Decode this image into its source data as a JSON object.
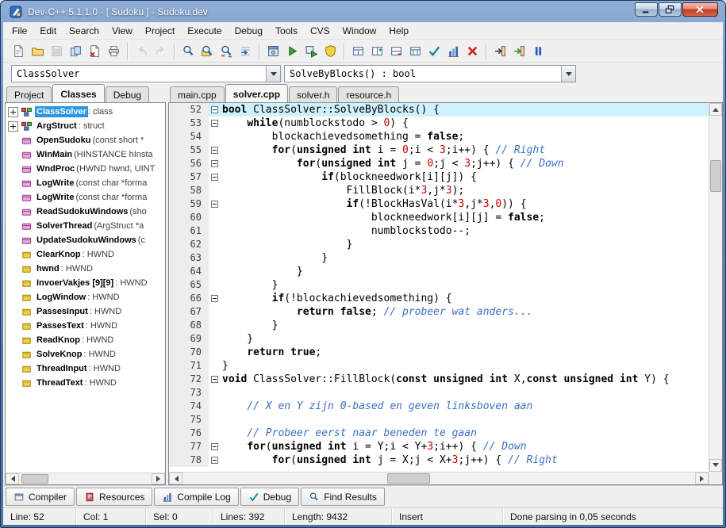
{
  "window": {
    "title": "Dev-C++ 5.1.1.0 - [ Sudoku ] - Sudoku.dev",
    "controls": [
      "minimize",
      "restore",
      "close"
    ]
  },
  "menu": {
    "items": [
      "File",
      "Edit",
      "Search",
      "View",
      "Project",
      "Execute",
      "Debug",
      "Tools",
      "CVS",
      "Window",
      "Help"
    ]
  },
  "toolbar": {
    "buttons": [
      {
        "name": "new-file"
      },
      {
        "name": "open"
      },
      {
        "name": "save",
        "disabled": true
      },
      {
        "name": "save-all"
      },
      {
        "name": "close-file"
      },
      {
        "name": "print"
      },
      {
        "sep": true
      },
      {
        "name": "undo",
        "disabled": true
      },
      {
        "name": "redo",
        "disabled": true
      },
      {
        "sep": true
      },
      {
        "name": "find"
      },
      {
        "name": "find-in-files"
      },
      {
        "name": "replace"
      },
      {
        "name": "goto-line"
      },
      {
        "sep": true
      },
      {
        "name": "compile"
      },
      {
        "name": "run"
      },
      {
        "name": "compile-run"
      },
      {
        "name": "rebuild-all"
      },
      {
        "sep": true
      },
      {
        "name": "project-new-source"
      },
      {
        "name": "project-add"
      },
      {
        "name": "project-remove"
      },
      {
        "name": "project-options"
      },
      {
        "name": "syntax-check"
      },
      {
        "name": "profile"
      },
      {
        "name": "abort"
      },
      {
        "sep": true
      },
      {
        "name": "goto-declaration"
      },
      {
        "name": "goto-implementation"
      },
      {
        "name": "pause"
      }
    ]
  },
  "navigator": {
    "class_selector": "ClassSolver",
    "member_selector": "SolveByBlocks() : bool"
  },
  "left_panel": {
    "tabs": [
      {
        "label": "Project"
      },
      {
        "label": "Classes",
        "active": true
      },
      {
        "label": "Debug"
      }
    ],
    "tree": [
      {
        "kind": "class",
        "expander": true,
        "name": "ClassSolver",
        "type": " : class",
        "selected": true
      },
      {
        "kind": "class",
        "expander": true,
        "name": "ArgStruct",
        "type": " : struct"
      },
      {
        "kind": "method",
        "name": "OpenSudoku",
        "type": " (const short *"
      },
      {
        "kind": "method",
        "name": "WinMain",
        "type": " (HINSTANCE hInsta"
      },
      {
        "kind": "method",
        "name": "WndProc",
        "type": " (HWND hwnd, UINT"
      },
      {
        "kind": "method",
        "name": "LogWrite",
        "type": " (const char *forma"
      },
      {
        "kind": "method",
        "name": "LogWrite",
        "type": " (const char *forma"
      },
      {
        "kind": "method",
        "name": "ReadSudokuWindows",
        "type": " (sho"
      },
      {
        "kind": "method",
        "name": "SolverThread",
        "type": " (ArgStruct *a"
      },
      {
        "kind": "method",
        "name": "UpdateSudokuWindows",
        "type": " (c"
      },
      {
        "kind": "var",
        "name": "ClearKnop",
        "type": " : HWND"
      },
      {
        "kind": "var",
        "name": "hwnd",
        "type": " : HWND"
      },
      {
        "kind": "var",
        "name": "InvoerVakjes [9][9]",
        "type": " : HWND"
      },
      {
        "kind": "var",
        "name": "LogWindow",
        "type": " : HWND"
      },
      {
        "kind": "var",
        "name": "PassesInput",
        "type": " : HWND"
      },
      {
        "kind": "var",
        "name": "PassesText",
        "type": " : HWND"
      },
      {
        "kind": "var",
        "name": "ReadKnop",
        "type": " : HWND"
      },
      {
        "kind": "var",
        "name": "SolveKnop",
        "type": " : HWND"
      },
      {
        "kind": "var",
        "name": "ThreadInput",
        "type": " : HWND"
      },
      {
        "kind": "var",
        "name": "ThreadText",
        "type": " : HWND"
      }
    ]
  },
  "editor": {
    "tabs": [
      {
        "label": "main.cpp"
      },
      {
        "label": "solver.cpp",
        "active": true
      },
      {
        "label": "solver.h"
      },
      {
        "label": "resource.h"
      }
    ],
    "current_line": 52,
    "lines": [
      {
        "n": 52,
        "fold": true,
        "seg": [
          [
            "k",
            "bool"
          ],
          [
            "p",
            " ClassSolver::SolveByBlocks() {"
          ]
        ]
      },
      {
        "n": 53,
        "fold": true,
        "seg": [
          [
            "p",
            "    "
          ],
          [
            "k",
            "while"
          ],
          [
            "p",
            "(numblockstodo > "
          ],
          [
            "n",
            "0"
          ],
          [
            "p",
            ") {"
          ]
        ]
      },
      {
        "n": 54,
        "fold": false,
        "seg": [
          [
            "p",
            "        blockachievedsomething = "
          ],
          [
            "k",
            "false"
          ],
          [
            "p",
            ";"
          ]
        ]
      },
      {
        "n": 55,
        "fold": true,
        "seg": [
          [
            "p",
            "        "
          ],
          [
            "k",
            "for"
          ],
          [
            "p",
            "("
          ],
          [
            "k",
            "unsigned"
          ],
          [
            "p",
            " "
          ],
          [
            "k",
            "int"
          ],
          [
            "p",
            " i = "
          ],
          [
            "n",
            "0"
          ],
          [
            "p",
            ";i < "
          ],
          [
            "n",
            "3"
          ],
          [
            "p",
            ";i++) { "
          ],
          [
            "c",
            "// Right"
          ]
        ]
      },
      {
        "n": 56,
        "fold": true,
        "seg": [
          [
            "p",
            "            "
          ],
          [
            "k",
            "for"
          ],
          [
            "p",
            "("
          ],
          [
            "k",
            "unsigned"
          ],
          [
            "p",
            " "
          ],
          [
            "k",
            "int"
          ],
          [
            "p",
            " j = "
          ],
          [
            "n",
            "0"
          ],
          [
            "p",
            ";j < "
          ],
          [
            "n",
            "3"
          ],
          [
            "p",
            ";j++) { "
          ],
          [
            "c",
            "// Down"
          ]
        ]
      },
      {
        "n": 57,
        "fold": true,
        "seg": [
          [
            "p",
            "                "
          ],
          [
            "k",
            "if"
          ],
          [
            "p",
            "(blockneedwork[i][j]) {"
          ]
        ]
      },
      {
        "n": 58,
        "fold": false,
        "seg": [
          [
            "p",
            "                    FillBlock(i*"
          ],
          [
            "n",
            "3"
          ],
          [
            "p",
            ",j*"
          ],
          [
            "n",
            "3"
          ],
          [
            "p",
            ");"
          ]
        ]
      },
      {
        "n": 59,
        "fold": true,
        "seg": [
          [
            "p",
            "                    "
          ],
          [
            "k",
            "if"
          ],
          [
            "p",
            "(!BlockHasVal(i*"
          ],
          [
            "n",
            "3"
          ],
          [
            "p",
            ",j*"
          ],
          [
            "n",
            "3"
          ],
          [
            "p",
            ","
          ],
          [
            "n",
            "0"
          ],
          [
            "p",
            ")) {"
          ]
        ]
      },
      {
        "n": 60,
        "fold": false,
        "seg": [
          [
            "p",
            "                        blockneedwork[i][j] = "
          ],
          [
            "k",
            "false"
          ],
          [
            "p",
            ";"
          ]
        ]
      },
      {
        "n": 61,
        "fold": false,
        "seg": [
          [
            "p",
            "                        numblockstodo--;"
          ]
        ]
      },
      {
        "n": 62,
        "fold": false,
        "seg": [
          [
            "p",
            "                    }"
          ]
        ]
      },
      {
        "n": 63,
        "fold": false,
        "seg": [
          [
            "p",
            "                }"
          ]
        ]
      },
      {
        "n": 64,
        "fold": false,
        "seg": [
          [
            "p",
            "            }"
          ]
        ]
      },
      {
        "n": 65,
        "fold": false,
        "seg": [
          [
            "p",
            "        }"
          ]
        ]
      },
      {
        "n": 66,
        "fold": true,
        "seg": [
          [
            "p",
            "        "
          ],
          [
            "k",
            "if"
          ],
          [
            "p",
            "(!blockachievedsomething) {"
          ]
        ]
      },
      {
        "n": 67,
        "fold": false,
        "seg": [
          [
            "p",
            "            "
          ],
          [
            "k",
            "return"
          ],
          [
            "p",
            " "
          ],
          [
            "k",
            "false"
          ],
          [
            "p",
            "; "
          ],
          [
            "c",
            "// probeer wat anders..."
          ]
        ]
      },
      {
        "n": 68,
        "fold": false,
        "seg": [
          [
            "p",
            "        }"
          ]
        ]
      },
      {
        "n": 69,
        "fold": false,
        "seg": [
          [
            "p",
            "    }"
          ]
        ]
      },
      {
        "n": 70,
        "fold": false,
        "seg": [
          [
            "p",
            "    "
          ],
          [
            "k",
            "return"
          ],
          [
            "p",
            " "
          ],
          [
            "k",
            "true"
          ],
          [
            "p",
            ";"
          ]
        ]
      },
      {
        "n": 71,
        "fold": false,
        "seg": [
          [
            "p",
            "}"
          ]
        ]
      },
      {
        "n": 72,
        "fold": true,
        "seg": [
          [
            "k",
            "void"
          ],
          [
            "p",
            " ClassSolver::FillBlock("
          ],
          [
            "k",
            "const"
          ],
          [
            "p",
            " "
          ],
          [
            "k",
            "unsigned"
          ],
          [
            "p",
            " "
          ],
          [
            "k",
            "int"
          ],
          [
            "p",
            " X,"
          ],
          [
            "k",
            "const"
          ],
          [
            "p",
            " "
          ],
          [
            "k",
            "unsigned"
          ],
          [
            "p",
            " "
          ],
          [
            "k",
            "int"
          ],
          [
            "p",
            " Y) {"
          ]
        ]
      },
      {
        "n": 73,
        "fold": false,
        "seg": []
      },
      {
        "n": 74,
        "fold": false,
        "seg": [
          [
            "p",
            "    "
          ],
          [
            "c",
            "// X en Y zijn 0-based en geven linksboven aan"
          ]
        ]
      },
      {
        "n": 75,
        "fold": false,
        "seg": []
      },
      {
        "n": 76,
        "fold": false,
        "seg": [
          [
            "p",
            "    "
          ],
          [
            "c",
            "// Probeer eerst naar beneden te gaan"
          ]
        ]
      },
      {
        "n": 77,
        "fold": true,
        "seg": [
          [
            "p",
            "    "
          ],
          [
            "k",
            "for"
          ],
          [
            "p",
            "("
          ],
          [
            "k",
            "unsigned"
          ],
          [
            "p",
            " "
          ],
          [
            "k",
            "int"
          ],
          [
            "p",
            " i = Y;i < Y+"
          ],
          [
            "n",
            "3"
          ],
          [
            "p",
            ";i++) { "
          ],
          [
            "c",
            "// Down"
          ]
        ]
      },
      {
        "n": 78,
        "fold": true,
        "seg": [
          [
            "p",
            "        "
          ],
          [
            "k",
            "for"
          ],
          [
            "p",
            "("
          ],
          [
            "k",
            "unsigned"
          ],
          [
            "p",
            " "
          ],
          [
            "k",
            "int"
          ],
          [
            "p",
            " j = X;j < X+"
          ],
          [
            "n",
            "3"
          ],
          [
            "p",
            ";j++) { "
          ],
          [
            "c",
            "// Right"
          ]
        ]
      }
    ]
  },
  "bottom_tabs": [
    {
      "icon": "compiler",
      "label": "Compiler"
    },
    {
      "icon": "resources",
      "label": "Resources"
    },
    {
      "icon": "compile-log",
      "label": "Compile Log"
    },
    {
      "icon": "debug",
      "label": "Debug"
    },
    {
      "icon": "find-results",
      "label": "Find Results"
    }
  ],
  "status": {
    "line": "Line: 52",
    "col": "Col: 1",
    "sel": "Sel: 0",
    "lines": "Lines: 392",
    "length": "Length: 9432",
    "mode": "Insert",
    "message": "Done parsing in 0,05 seconds"
  }
}
